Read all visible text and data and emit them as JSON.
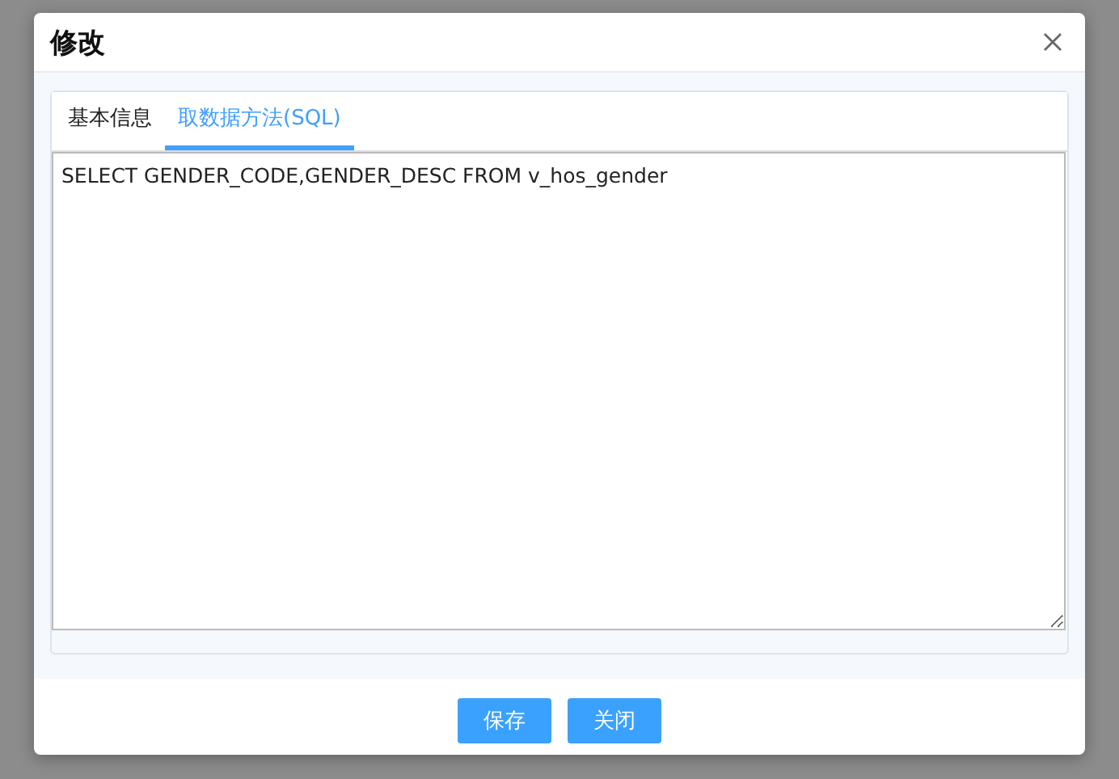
{
  "dialog": {
    "title": "修改"
  },
  "tabs": [
    {
      "label": "基本信息",
      "selected": false
    },
    {
      "label": "取数据方法(SQL)",
      "selected": true
    }
  ],
  "sql_editor": {
    "value": "SELECT GENDER_CODE,GENDER_DESC FROM v_hos_gender"
  },
  "buttons": [
    "保存",
    "关闭"
  ]
}
